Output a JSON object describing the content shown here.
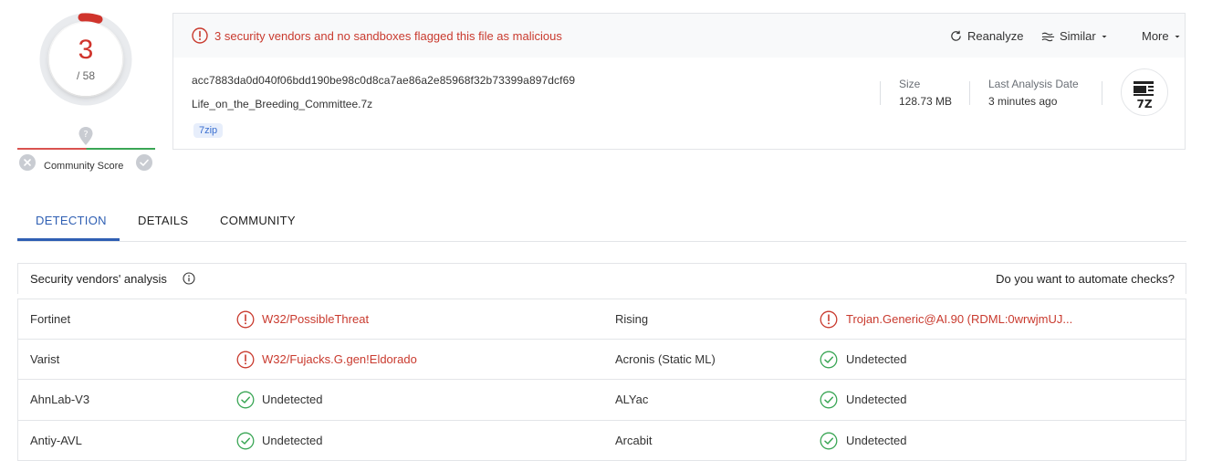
{
  "score": {
    "detections": "3",
    "total": "/ 58"
  },
  "community": {
    "label": "Community Score"
  },
  "alert": {
    "text": "3 security vendors and no sandboxes flagged this file as malicious"
  },
  "actions": {
    "reanalyze": "Reanalyze",
    "similar": "Similar",
    "more": "More"
  },
  "file": {
    "hash": "acc7883da0d040f06bdd190be98c0d8ca7ae86a2e85968f32b73399a897dcf69",
    "name": "Life_on_the_Breeding_Committee.7z",
    "tag": "7zip",
    "size_label": "Size",
    "size_value": "128.73 MB",
    "date_label": "Last Analysis Date",
    "date_value": "3 minutes ago",
    "type_icon_text": "7Z"
  },
  "tabs": [
    {
      "label": "DETECTION",
      "active": true
    },
    {
      "label": "DETAILS",
      "active": false
    },
    {
      "label": "COMMUNITY",
      "active": false
    }
  ],
  "analysis": {
    "title": "Security vendors' analysis",
    "automate": "Do you want to automate checks?",
    "rows": [
      {
        "left": {
          "vendor": "Fortinet",
          "result": "W32/PossibleThreat",
          "status": "malicious"
        },
        "right": {
          "vendor": "Rising",
          "result": "Trojan.Generic@AI.90 (RDML:0wrwjmUJ...",
          "status": "malicious"
        }
      },
      {
        "left": {
          "vendor": "Varist",
          "result": "W32/Fujacks.G.gen!Eldorado",
          "status": "malicious"
        },
        "right": {
          "vendor": "Acronis (Static ML)",
          "result": "Undetected",
          "status": "undetected"
        }
      },
      {
        "left": {
          "vendor": "AhnLab-V3",
          "result": "Undetected",
          "status": "undetected"
        },
        "right": {
          "vendor": "ALYac",
          "result": "Undetected",
          "status": "undetected"
        }
      },
      {
        "left": {
          "vendor": "Antiy-AVL",
          "result": "Undetected",
          "status": "undetected"
        },
        "right": {
          "vendor": "Arcabit",
          "result": "Undetected",
          "status": "undetected"
        }
      }
    ]
  },
  "colors": {
    "malicious": "#c93a2e",
    "undetected": "#3aa655",
    "accent": "#2f5fb3"
  }
}
